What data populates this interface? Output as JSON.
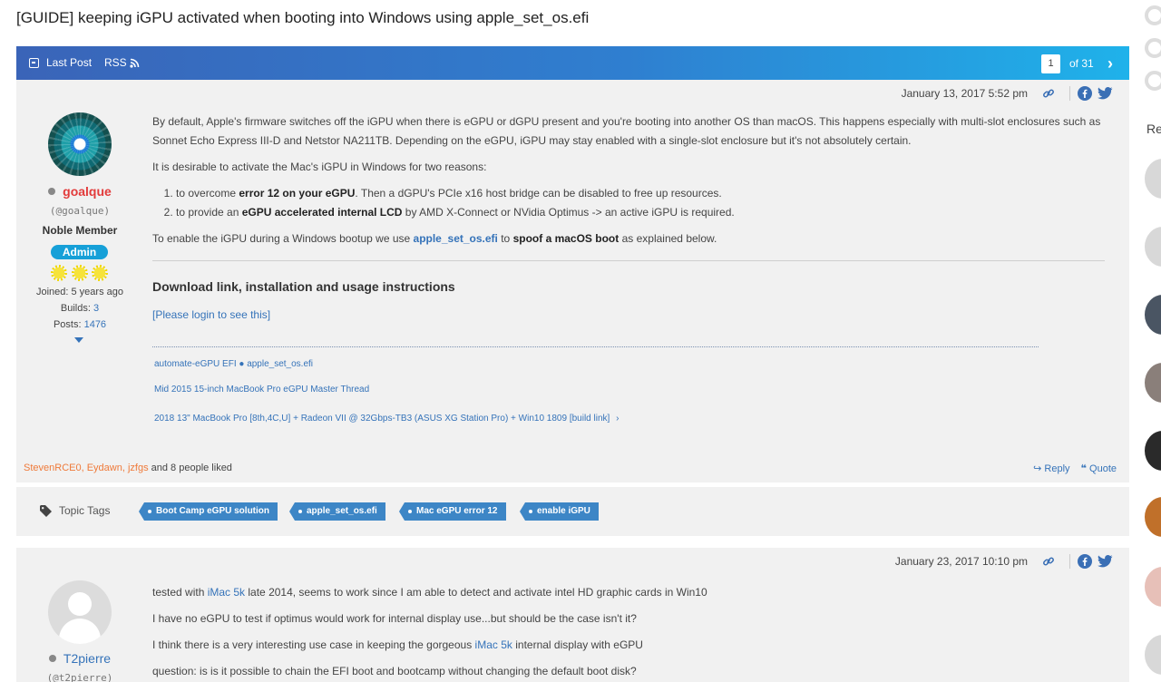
{
  "thread": {
    "title": "[GUIDE] keeping iGPU activated when booting into Windows using apple_set_os.efi"
  },
  "topbar": {
    "last_post": "Last Post",
    "rss": "RSS",
    "page": "1",
    "of_pages": "of 31",
    "next": "›"
  },
  "post1": {
    "date": "January 13, 2017 5:52 pm",
    "author": {
      "name": "goalque",
      "handle": "(@goalque)",
      "rank": "Noble Member",
      "badge": "Admin",
      "joined": "Joined: 5 years ago",
      "builds_label": "Builds:",
      "builds": "3",
      "posts_label": "Posts:",
      "posts": "1476"
    },
    "para1": "By default, Apple's firmware switches off the iGPU when there is eGPU or dGPU present and you're booting into another OS than macOS. This happens especially with multi-slot enclosures such as Sonnet Echo Express III-D and Netstor NA211TB. Depending on the eGPU, iGPU may stay enabled with a single-slot enclosure but it's not absolutely certain.",
    "para2": "It is desirable to activate the Mac's iGPU in Windows for two reasons:",
    "li1_pre": "to overcome ",
    "li1_bold": "error 12 on your eGPU",
    "li1_post": ". Then a dGPU's PCIe x16 host bridge can be disabled to free up resources.",
    "li2_pre": "to provide an ",
    "li2_bold": "eGPU accelerated internal LCD",
    "li2_post": " by AMD X-Connect or NVidia Optimus -> an active iGPU is required.",
    "para3_pre": "To enable the iGPU during a Windows bootup we use ",
    "para3_link": "apple_set_os.efi",
    "para3_mid": " to ",
    "para3_bold": "spoof a macOS boot",
    "para3_post": " as explained below.",
    "section_title": "Download link, installation and usage instructions",
    "login_link": "[Please login to see this]",
    "sig1": "automate-eGPU EFI ● apple_set_os.efi",
    "sig2": "Mid 2015 15-inch MacBook Pro eGPU Master Thread",
    "sig3": "2018 13\" MacBook Pro [8th,4C,U] + Radeon VII @ 32Gbps-TB3 (ASUS XG Station Pro) + Win10 1809 [build link]",
    "likes_users": "StevenRCE0, Eydawn, jzfgs",
    "likes_rest": " and 8 people liked",
    "reply": "Reply",
    "quote": "Quote"
  },
  "tags": {
    "label": "Topic Tags",
    "items": [
      "Boot Camp eGPU solution",
      "apple_set_os.efi",
      "Mac eGPU error 12",
      "enable iGPU"
    ]
  },
  "post2": {
    "date": "January 23, 2017 10:10 pm",
    "author": {
      "name": "T2pierre",
      "handle": "(@t2pierre)"
    },
    "line1_pre": "tested with ",
    "line1_link": "iMac 5k",
    "line1_post": " late 2014, seems to work since I am able to detect and activate intel HD graphic cards in Win10",
    "line2": "I have no eGPU to test if optimus would work for internal display use...but should be the case isn't it?",
    "line3_pre": "I think there is a very interesting use case in keeping the gorgeous ",
    "line3_link": "iMac 5k",
    "line3_post": " internal display with eGPU",
    "line4": "question: is is it possible to chain the EFI boot and bootcamp without changing the default boot disk?"
  },
  "sidebar": {
    "label": "Re"
  },
  "colors": {
    "brand_blue": "#3a64b8",
    "accent_cyan": "#1fb2ea",
    "admin_badge": "#16a0d8",
    "tag_blue": "#3d86c6",
    "username_red": "#e23b3b",
    "link_blue": "#3573b9"
  }
}
